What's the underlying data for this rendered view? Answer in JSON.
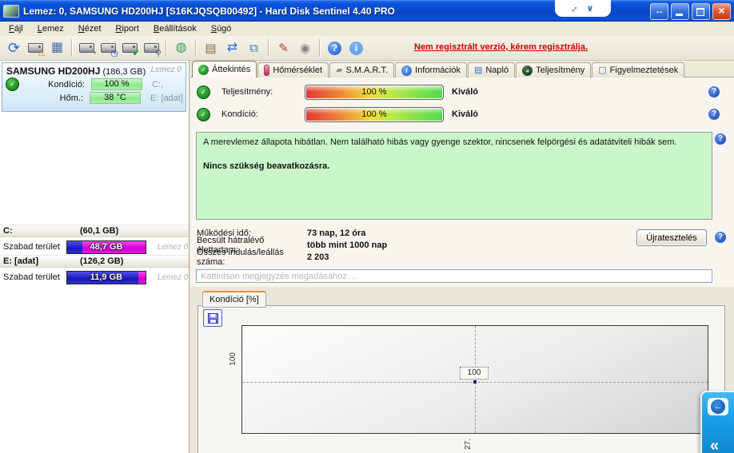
{
  "window": {
    "title": "Lemez: 0, SAMSUNG HD200HJ [S16KJQSQB00492]  -  Hard Disk Sentinel 4.40 PRO",
    "controls": [
      "resize-horizontal",
      "minimize",
      "restore",
      "close"
    ]
  },
  "menu": {
    "items": [
      "Fájl",
      "Lemez",
      "Nézet",
      "Riport",
      "Beállítások",
      "Súgó"
    ]
  },
  "toolbar": {
    "groups": [
      [
        "refresh-icon",
        "report-problem-icon",
        "disk-monitor-icon"
      ],
      [
        "disk-performance-icon",
        "disk-clock-icon",
        "disk-ok-icon",
        "disk-search-icon"
      ],
      [
        "network-disk-icon"
      ],
      [
        "report-icon",
        "sync-icon",
        "network-icon"
      ],
      [
        "desktop-settings-icon",
        "sound-icon"
      ],
      [
        "help-icon",
        "info-icon"
      ]
    ]
  },
  "registration": {
    "text": "Nem regisztrált verzió, kérem regisztrálja."
  },
  "sidebar": {
    "device": {
      "name": "SAMSUNG HD200HJ",
      "size": "(186,3 GB)",
      "disk": "Lemez 0",
      "rows": [
        {
          "label": "Kondíció:",
          "value": "100 %",
          "right": "C:,"
        },
        {
          "label": "Hőm.:",
          "value": "38 °C",
          "right": "E: [adat]"
        }
      ]
    },
    "partitions": [
      {
        "name": "C:",
        "size": "(60,1 GB)",
        "free_label": "Szabad terület",
        "free": "48,7 GB",
        "disk": "Lemez 0",
        "used_pct": 19
      },
      {
        "name": "E: [adat]",
        "size": "(126,2 GB)",
        "free_label": "Szabad terület",
        "free": "11,9 GB",
        "disk": "Lemez 0",
        "used_pct": 91
      }
    ]
  },
  "tabs": [
    {
      "label": "Áttekintés",
      "icon": "overview-check-icon",
      "active": true
    },
    {
      "label": "Hőmérséklet",
      "icon": "thermometer-icon",
      "active": false
    },
    {
      "label": "S.M.A.R.T.",
      "icon": "smart-icon",
      "active": false
    },
    {
      "label": "Információk",
      "icon": "information-icon",
      "active": false
    },
    {
      "label": "Napló",
      "icon": "log-icon",
      "active": false
    },
    {
      "label": "Teljesítmény",
      "icon": "performance-icon",
      "active": false
    },
    {
      "label": "Figyelmeztetések",
      "icon": "warnings-icon",
      "active": false
    }
  ],
  "overview": {
    "gauges": [
      {
        "label": "Teljesítmény:",
        "value": "100 %",
        "rating": "Kiváló",
        "pct": 100
      },
      {
        "label": "Kondíció:",
        "value": "100 %",
        "rating": "Kiváló",
        "pct": 100
      }
    ],
    "status_line1": "A merevlemez állapota hibátlan. Nem található hibás vagy gyenge szektor, nincsenek felpörgési és adatátviteli hibák sem.",
    "status_line2": "Nincs szükség beavatkozásra.",
    "stats": [
      {
        "label": "Működési idő:",
        "value": "73 nap, 12 óra"
      },
      {
        "label": "Becsült hátralévő élettartam:",
        "value": "több mint 1000 nap"
      },
      {
        "label": "Összes indulás/leállás száma:",
        "value": "2 203"
      }
    ],
    "retest_label": "Újratesztelés",
    "comment_placeholder": "Kattintson megjegyzés megadásához ..."
  },
  "chart_data": {
    "type": "line",
    "title": "Kondíció [%]",
    "x": [
      "27."
    ],
    "series": [
      {
        "name": "Kondíció",
        "values": [
          100
        ]
      }
    ],
    "y_ticks": [
      "100"
    ],
    "x_ticks": [
      "27."
    ],
    "annotations": [
      {
        "x": "27.",
        "y": 100,
        "label": "100"
      }
    ],
    "ylabel": "",
    "xlabel": "",
    "grid": "dashed-crosshair",
    "legend": false
  },
  "colors": {
    "titlebar_blue": "#0a52da",
    "registration_red": "#cc0000",
    "status_green_bg": "#caf7ca",
    "sidebar_bar_green": "#8ce88c",
    "used_blue": "#1818b8",
    "free_magenta": "#cc00cc",
    "gauge_gradient": [
      "#e03838",
      "#f0dc40",
      "#50da50"
    ],
    "teamviewer_blue": "#18a0e8"
  },
  "overlay": {
    "teamviewer": "teamviewer-icon"
  }
}
